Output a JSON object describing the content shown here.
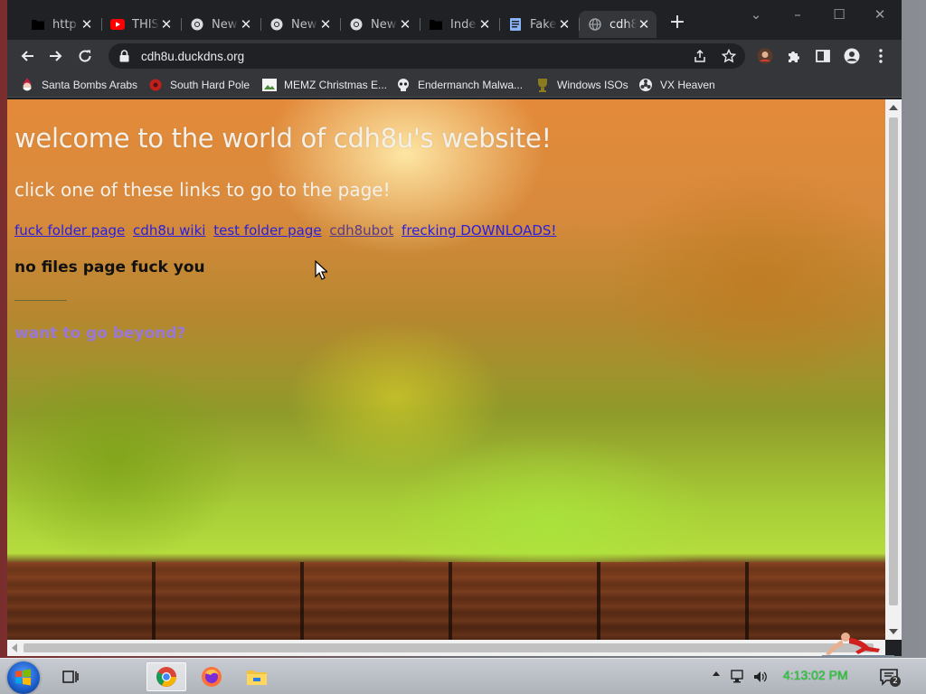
{
  "tabs": [
    {
      "title": "http",
      "favicon": "folder-icon"
    },
    {
      "title": "THIS",
      "favicon": "youtube-icon"
    },
    {
      "title": "New",
      "favicon": "chrome-icon"
    },
    {
      "title": "New",
      "favicon": "chrome-icon"
    },
    {
      "title": "New",
      "favicon": "chrome-icon"
    },
    {
      "title": "Inde",
      "favicon": "folder-icon"
    },
    {
      "title": "Fake",
      "favicon": "document-icon"
    },
    {
      "title": "cdh8",
      "favicon": "globe-icon",
      "active": true
    }
  ],
  "toolbar": {
    "url": "cdh8u.duckdns.org"
  },
  "bookmarks": [
    {
      "label": "Santa Bombs Arabs"
    },
    {
      "label": "South Hard Pole"
    },
    {
      "label": "MEMZ Christmas E..."
    },
    {
      "label": "Endermanch Malwa..."
    },
    {
      "label": "Windows ISOs"
    },
    {
      "label": "VX Heaven"
    }
  ],
  "page": {
    "title": "welcome to the world of cdh8u's website!",
    "subtitle": "click one of these links to go to the page!",
    "links": [
      {
        "label": "fuck folder page",
        "visited": false
      },
      {
        "label": "cdh8u wiki",
        "visited": false
      },
      {
        "label": "test folder page",
        "visited": false
      },
      {
        "label": "cdh8ubot",
        "visited": true
      },
      {
        "label": "frecking DOWNLOADS!",
        "visited": false
      }
    ],
    "no_files": "no files page fuck you",
    "beyond": "want to go beyond?"
  },
  "taskbar": {
    "clock": "4:13:02 PM",
    "notification_count": "2"
  },
  "colors": {
    "tab_strip": "#202124",
    "toolbar": "#35363a",
    "link": "#2a1ee0",
    "link_visited": "#5a3a8a",
    "beyond": "#9a78d8",
    "clock": "#2ad02a"
  }
}
